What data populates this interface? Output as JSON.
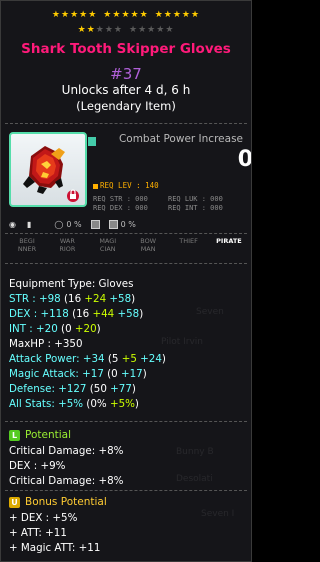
{
  "stars": {
    "row1": [
      true,
      true,
      true,
      true,
      true,
      true,
      true,
      true,
      true,
      true,
      true,
      true,
      true,
      true,
      true
    ],
    "row2": [
      true,
      true,
      false,
      false,
      false,
      false,
      false,
      false,
      false,
      false
    ]
  },
  "item": {
    "name": "Shark Tooth Skipper Gloves",
    "number": "#37",
    "unlock_text": "Unlocks after 4 d, 6 h",
    "rarity_text": "(Legendary Item)"
  },
  "combat": {
    "label": "Combat Power Increase",
    "value": "0"
  },
  "requirements": {
    "lev": "REQ LEV : 140",
    "str": "REQ STR : 000",
    "luk": "REQ LUK : 000",
    "dex": "REQ DEX : 000",
    "int": "REQ INT : 000"
  },
  "status_row": {
    "pct1": "0 %",
    "pct2": "0 %"
  },
  "jobs": [
    {
      "label": "BEGI\nNNER",
      "active": false
    },
    {
      "label": "WAR\nRIOR",
      "active": false
    },
    {
      "label": "MAGI\nCIAN",
      "active": false
    },
    {
      "label": "BOW\nMAN",
      "active": false
    },
    {
      "label": "THIEF",
      "active": false
    },
    {
      "label": "PIRATE",
      "active": true
    }
  ],
  "stats": {
    "equip_type": "Equipment Type: Gloves",
    "str": {
      "label": "STR : +98",
      "open": " (16 ",
      "flame": "+24",
      "star": " +58",
      "close": ")"
    },
    "dex": {
      "label": "DEX : +118",
      "open": " (16 ",
      "flame": "+44",
      "star": " +58",
      "close": ")"
    },
    "int": {
      "label": "INT : +20",
      "open": " (0 ",
      "flame": "+20",
      "close": ")"
    },
    "maxhp": "MaxHP : +350",
    "attack": {
      "label": "Attack Power: +34",
      "open": " (5 ",
      "flame": "+5",
      "star": " +24",
      "close": ")"
    },
    "magic": {
      "label": "Magic Attack: +17",
      "open": " (0 ",
      "star": "+17",
      "close": ")"
    },
    "defense": {
      "label": "Defense: +127",
      "open": " (50 ",
      "star": "+77",
      "close": ")"
    },
    "allstats": {
      "label": "All Stats: +5%",
      "open": " (0% ",
      "flame": "+5%",
      "close": ")"
    }
  },
  "potential": {
    "badge": "L",
    "title": "Potential",
    "lines": [
      "Critical Damage: +8%",
      "DEX : +9%",
      "Critical Damage: +8%"
    ],
    "badge_color": "#55cc22",
    "title_color": "#99ee33"
  },
  "bonus_potential": {
    "badge": "U",
    "title": "Bonus Potential",
    "lines": [
      "+ DEX : +5%",
      "+ ATT: +11",
      "+ Magic ATT: +11"
    ],
    "badge_color": "#ddaa00",
    "title_color": "#ffcc33"
  },
  "colors": {
    "name": "#ff1a7a",
    "number": "#b060d8",
    "border_accent": "#55ddaa",
    "req_lev": "#ffb000"
  }
}
